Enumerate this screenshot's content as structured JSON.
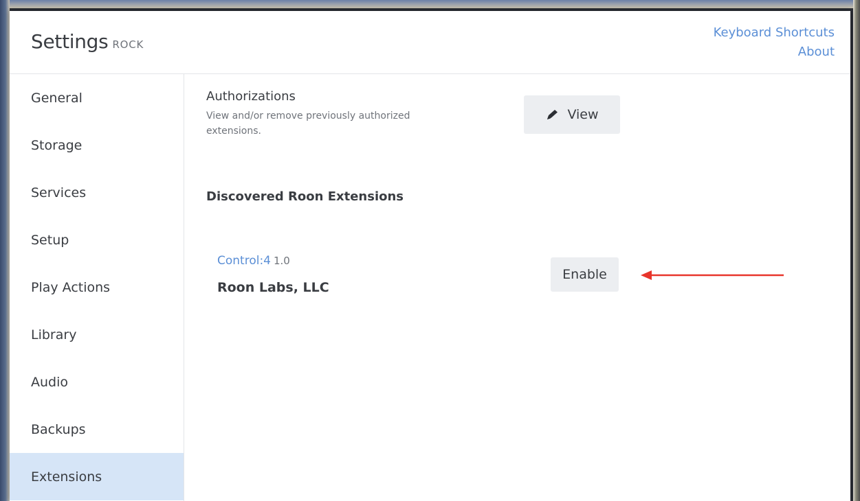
{
  "header": {
    "title": "Settings",
    "subtitle": "ROCK",
    "links": {
      "keyboard_shortcuts": "Keyboard Shortcuts",
      "about": "About"
    }
  },
  "sidebar": {
    "items": [
      {
        "label": "General"
      },
      {
        "label": "Storage"
      },
      {
        "label": "Services"
      },
      {
        "label": "Setup"
      },
      {
        "label": "Play Actions"
      },
      {
        "label": "Library"
      },
      {
        "label": "Audio"
      },
      {
        "label": "Backups"
      },
      {
        "label": "Extensions",
        "active": true
      }
    ]
  },
  "authorizations": {
    "title": "Authorizations",
    "description": "View and/or remove previously authorized extensions.",
    "view_button": "View",
    "view_icon": "pencil-icon"
  },
  "discovered": {
    "title": "Discovered Roon Extensions",
    "extensions": [
      {
        "name": "Control:4",
        "version": "1.0",
        "vendor": "Roon Labs, LLC",
        "action_label": "Enable"
      }
    ]
  },
  "annotation": {
    "arrow_color": "#e8352b"
  },
  "colors": {
    "accent": "#5b8fd6",
    "active_nav": "#d6e5f7",
    "button_bg": "#eceef1"
  }
}
